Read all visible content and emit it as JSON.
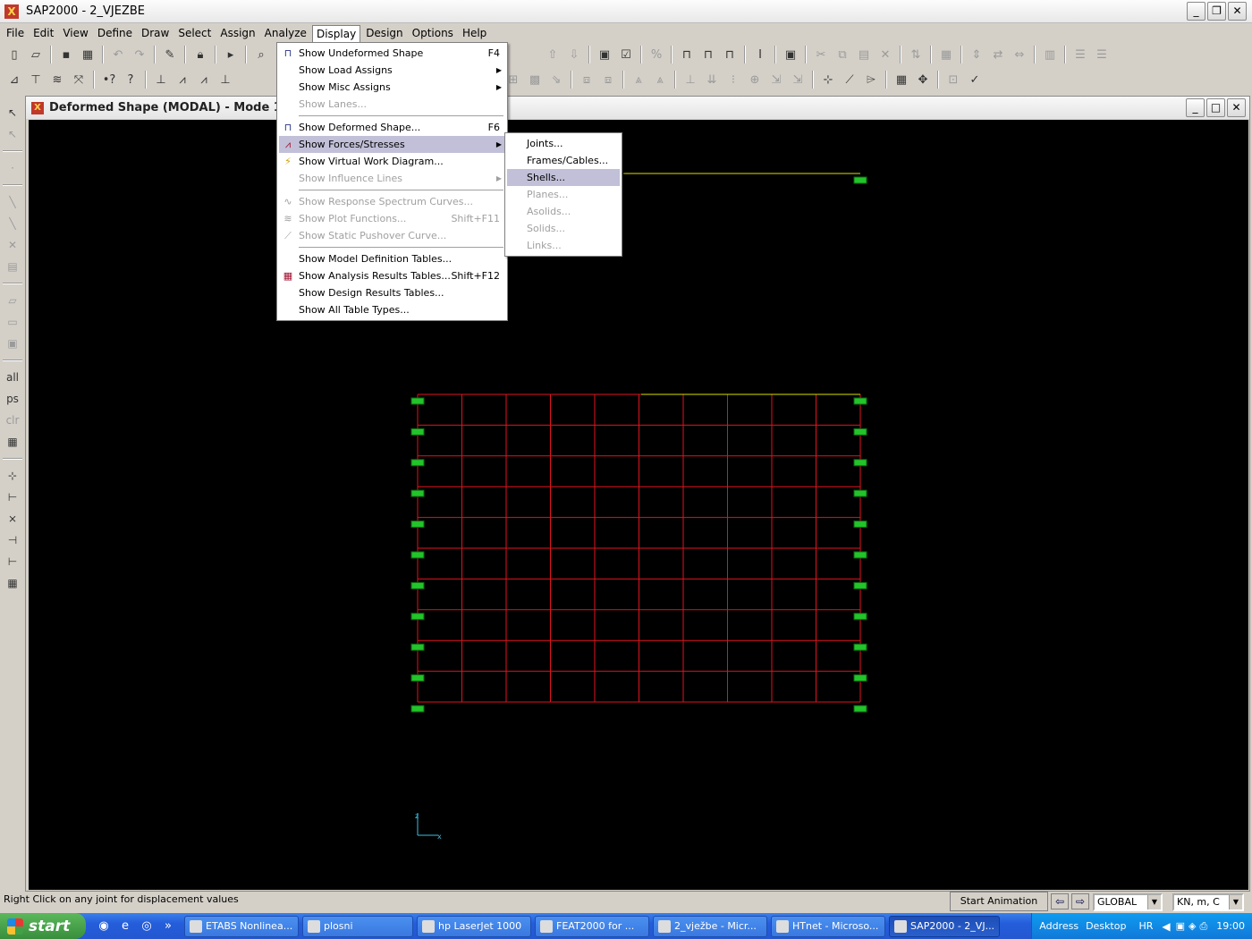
{
  "app": {
    "title": "SAP2000 - 2_VJEZBE"
  },
  "menubar": [
    "File",
    "Edit",
    "View",
    "Define",
    "Draw",
    "Select",
    "Assign",
    "Analyze",
    "Display",
    "Design",
    "Options",
    "Help"
  ],
  "inner_window": {
    "title": "Deformed Shape (MODAL) - Mode 1 - Peric"
  },
  "display_menu": {
    "items": [
      {
        "label": "Show Undeformed Shape",
        "shortcut": "F4",
        "enabled": true,
        "icon": "frame-icon"
      },
      {
        "label": "Show Load Assigns",
        "submenu": true,
        "enabled": true
      },
      {
        "label": "Show Misc Assigns",
        "submenu": true,
        "enabled": true
      },
      {
        "label": "Show Lanes...",
        "enabled": false
      },
      {
        "sep": true
      },
      {
        "label": "Show  Deformed Shape...",
        "shortcut": "F6",
        "enabled": true,
        "icon": "deformed-icon"
      },
      {
        "label": "Show Forces/Stresses",
        "submenu": true,
        "enabled": true,
        "highlighted": true,
        "icon": "forces-icon"
      },
      {
        "label": "Show Virtual Work Diagram...",
        "enabled": true,
        "icon": "lightning-icon"
      },
      {
        "label": "Show Influence Lines",
        "submenu": true,
        "enabled": false
      },
      {
        "sep": true
      },
      {
        "label": "Show Response Spectrum Curves...",
        "enabled": false,
        "icon": "curve-icon"
      },
      {
        "label": "Show Plot Functions...",
        "shortcut": "Shift+F11",
        "enabled": false,
        "icon": "plot-icon"
      },
      {
        "label": "Show Static Pushover Curve...",
        "enabled": false,
        "icon": "pushover-icon"
      },
      {
        "sep": true
      },
      {
        "label": "Show Model Definition Tables...",
        "enabled": true
      },
      {
        "label": "Show Analysis Results Tables...",
        "shortcut": "Shift+F12",
        "enabled": true,
        "icon": "table-icon"
      },
      {
        "label": "Show Design Results Tables...",
        "enabled": true
      },
      {
        "label": "Show All Table Types...",
        "enabled": true
      }
    ]
  },
  "forces_submenu": {
    "items": [
      {
        "label": "Joints...",
        "enabled": true
      },
      {
        "label": "Frames/Cables...",
        "enabled": true
      },
      {
        "label": "Shells...",
        "enabled": true,
        "highlighted": true
      },
      {
        "label": "Planes...",
        "enabled": false
      },
      {
        "label": "Asolids...",
        "enabled": false
      },
      {
        "label": "Solids...",
        "enabled": false
      },
      {
        "label": "Links...",
        "enabled": false
      }
    ]
  },
  "axis": {
    "z": "z",
    "x": "x"
  },
  "status": {
    "message": "Right Click on any joint for displacement values",
    "animation_button": "Start Animation",
    "coord_system": "GLOBAL",
    "units": "KN, m, C"
  },
  "taskbar": {
    "start": "start",
    "tasks": [
      "ETABS Nonlinea...",
      "plosni",
      "hp LaserJet 1000",
      "FEAT2000 for ...",
      "2_vježbe - Micr...",
      "HTnet - Microso...",
      "SAP2000 - 2_VJ..."
    ],
    "address": "Address",
    "desktop": "Desktop",
    "lang": "HR",
    "time": "19:00"
  },
  "colors": {
    "shell_mesh": "#e0141e",
    "support": "#22c42a",
    "undeformed": "#d8e000",
    "viewport_bg": "#000000",
    "axis": "#3cc0e0"
  }
}
